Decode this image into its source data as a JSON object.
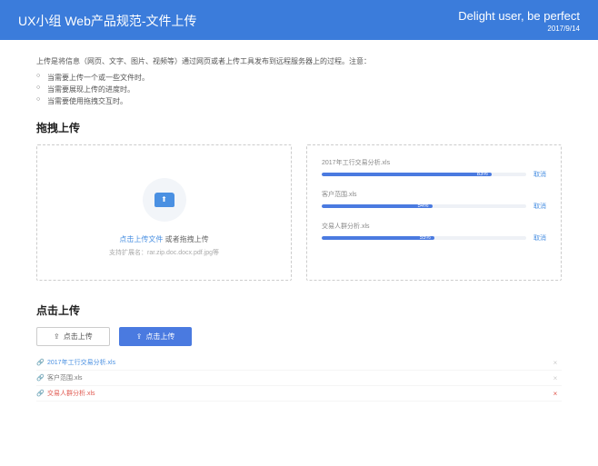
{
  "header": {
    "title": "UX小组 Web产品规范-文件上传",
    "slogan": "Delight user, be perfect",
    "date": "2017/9/14"
  },
  "intro": "上传是将信息（网页、文字、图片、视频等）通过网页或者上传工具发布到远程服务器上的过程。注意：",
  "bullets": [
    "当需要上传一个或一些文件时。",
    "当需要展现上传的进度时。",
    "当需要使用拖拽交互时。"
  ],
  "section_drag": "拖拽上传",
  "drag_left": {
    "link": "点击上传文件",
    "text": " 或者拖拽上传",
    "hint": "支持扩展名：rar.zip.doc.docx.pdf.jpg等"
  },
  "drag_right": {
    "cancel_label": "取消",
    "items": [
      {
        "name": "2017年工行交易分析.xls",
        "pct": 83
      },
      {
        "name": "客户范围.xls",
        "pct": 54
      },
      {
        "name": "交易人群分析.xls",
        "pct": 55
      }
    ]
  },
  "section_click": "点击上传",
  "btn_outline": "点击上传",
  "btn_primary": "点击上传",
  "files": [
    {
      "name": "2017年工行交易分析.xls",
      "state": "link"
    },
    {
      "name": "客户范围.xls",
      "state": "normal"
    },
    {
      "name": "交易人群分析.xls",
      "state": "error"
    }
  ]
}
